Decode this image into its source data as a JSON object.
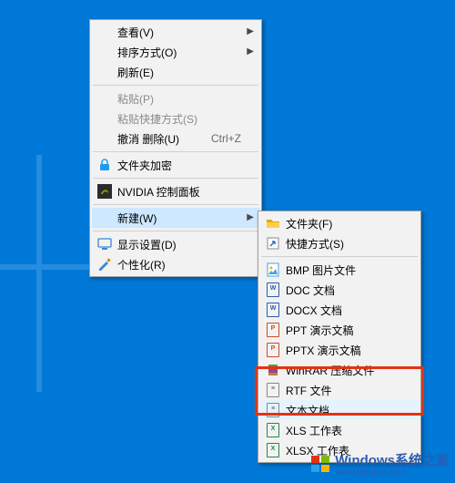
{
  "menu1": {
    "view": {
      "label": "查看(V)"
    },
    "sort": {
      "label": "排序方式(O)"
    },
    "refresh": {
      "label": "刷新(E)"
    },
    "paste": {
      "label": "粘贴(P)"
    },
    "pasteShort": {
      "label": "粘贴快捷方式(S)"
    },
    "undo": {
      "label": "撤消 删除(U)",
      "shortcut": "Ctrl+Z"
    },
    "folderLock": {
      "label": "文件夹加密"
    },
    "nvidia": {
      "label": "NVIDIA 控制面板"
    },
    "new": {
      "label": "新建(W)"
    },
    "display": {
      "label": "显示设置(D)"
    },
    "personalize": {
      "label": "个性化(R)"
    }
  },
  "menu2": {
    "folder": {
      "label": "文件夹(F)"
    },
    "shortcut": {
      "label": "快捷方式(S)"
    },
    "bmp": {
      "label": "BMP 图片文件"
    },
    "doc": {
      "label": "DOC 文档"
    },
    "docx": {
      "label": "DOCX 文档"
    },
    "ppt": {
      "label": "PPT 演示文稿"
    },
    "pptx": {
      "label": "PPTX 演示文稿"
    },
    "rar": {
      "label": "WinRAR 压缩文件"
    },
    "rtf": {
      "label": "RTF 文件"
    },
    "txt": {
      "label": "文本文档"
    },
    "xls": {
      "label": "XLS 工作表"
    },
    "xlsx": {
      "label": "XLSX 工作表"
    }
  },
  "watermark": {
    "brand": "Windows",
    "tagline": "系统之家",
    "url": "www.bjjmmc.com"
  }
}
